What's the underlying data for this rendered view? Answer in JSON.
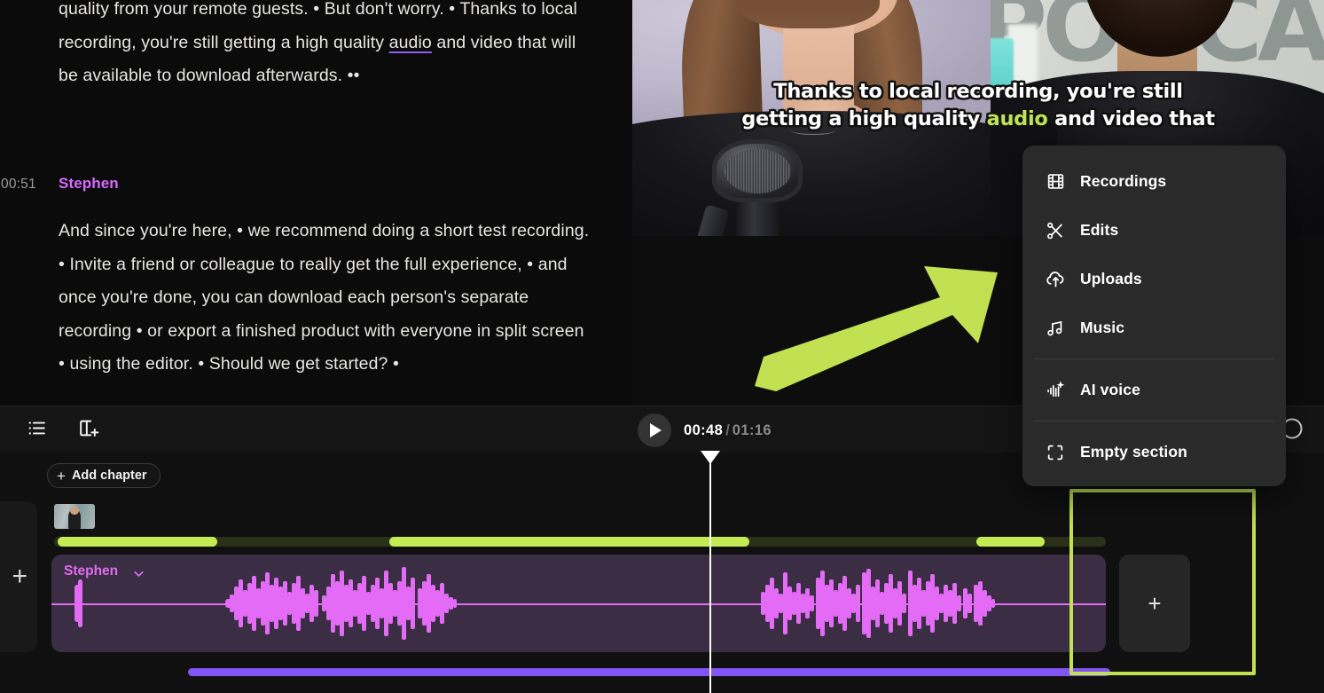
{
  "transcript": {
    "paragraph_1": "quality from your remote guests. • But don't worry. • Thanks to local recording, you're still getting a high quality ",
    "paragraph_1_link": "audio",
    "paragraph_1_tail": " and video that will be available to download afterwards. ••",
    "timestamp": "00:51",
    "speaker": "Stephen",
    "paragraph_2": "And since you're here, • we recommend doing a short test recording. • Invite a friend or colleague to really get the full experience, • and once you're done, you can download each person's separate recording • or export a finished product with everyone in split screen • using the editor. • Should we get started? •"
  },
  "preview": {
    "caption_line_1": "Thanks to local recording, you're still",
    "caption_line_2_pre": "getting a high quality ",
    "caption_line_2_highlight": "audio",
    "caption_line_2_post": " and video that",
    "highlight_color": "#bfe356",
    "background_text": "PODCAST"
  },
  "menu": {
    "items": [
      {
        "label": "Recordings",
        "icon": "film-icon"
      },
      {
        "label": "Edits",
        "icon": "scissors-icon"
      },
      {
        "label": "Uploads",
        "icon": "cloud-upload-icon"
      },
      {
        "label": "Music",
        "icon": "music-note-icon"
      },
      {
        "label": "AI voice",
        "icon": "ai-voice-icon"
      },
      {
        "label": "Empty section",
        "icon": "empty-frame-icon"
      }
    ]
  },
  "toolbar": {
    "list_icon": "list-icon",
    "split_icon": "add-panel-icon",
    "play_icon": "play-icon",
    "current_time": "00:48",
    "separator": "/",
    "total_time": "01:16",
    "right_icon": "circle-icon"
  },
  "timeline": {
    "add_chapter_label": "Add chapter",
    "add_chapter_plus": "+",
    "rail_plus": "+",
    "clip_name": "Stephen",
    "empty_section_plus": "+",
    "chapter_segments": [
      {
        "left_pct": 0.3,
        "width_pct": 15.2
      },
      {
        "left_pct": 31.9,
        "width_pct": 34.2
      },
      {
        "left_pct": 87.7,
        "width_pct": 6.5
      }
    ],
    "chapter_track_color": "#c2ec52",
    "chapter_track_bg": "#2b3018",
    "waveform_color": "#e36bf5",
    "clip_color": "#3a2d44",
    "scrollbar_color": "#8054f5",
    "highlight_box_color": "#c2e152"
  },
  "annotation": {
    "arrow_color": "#c2e152",
    "arrow_label": "green-arrow-pointing-to-menu"
  }
}
